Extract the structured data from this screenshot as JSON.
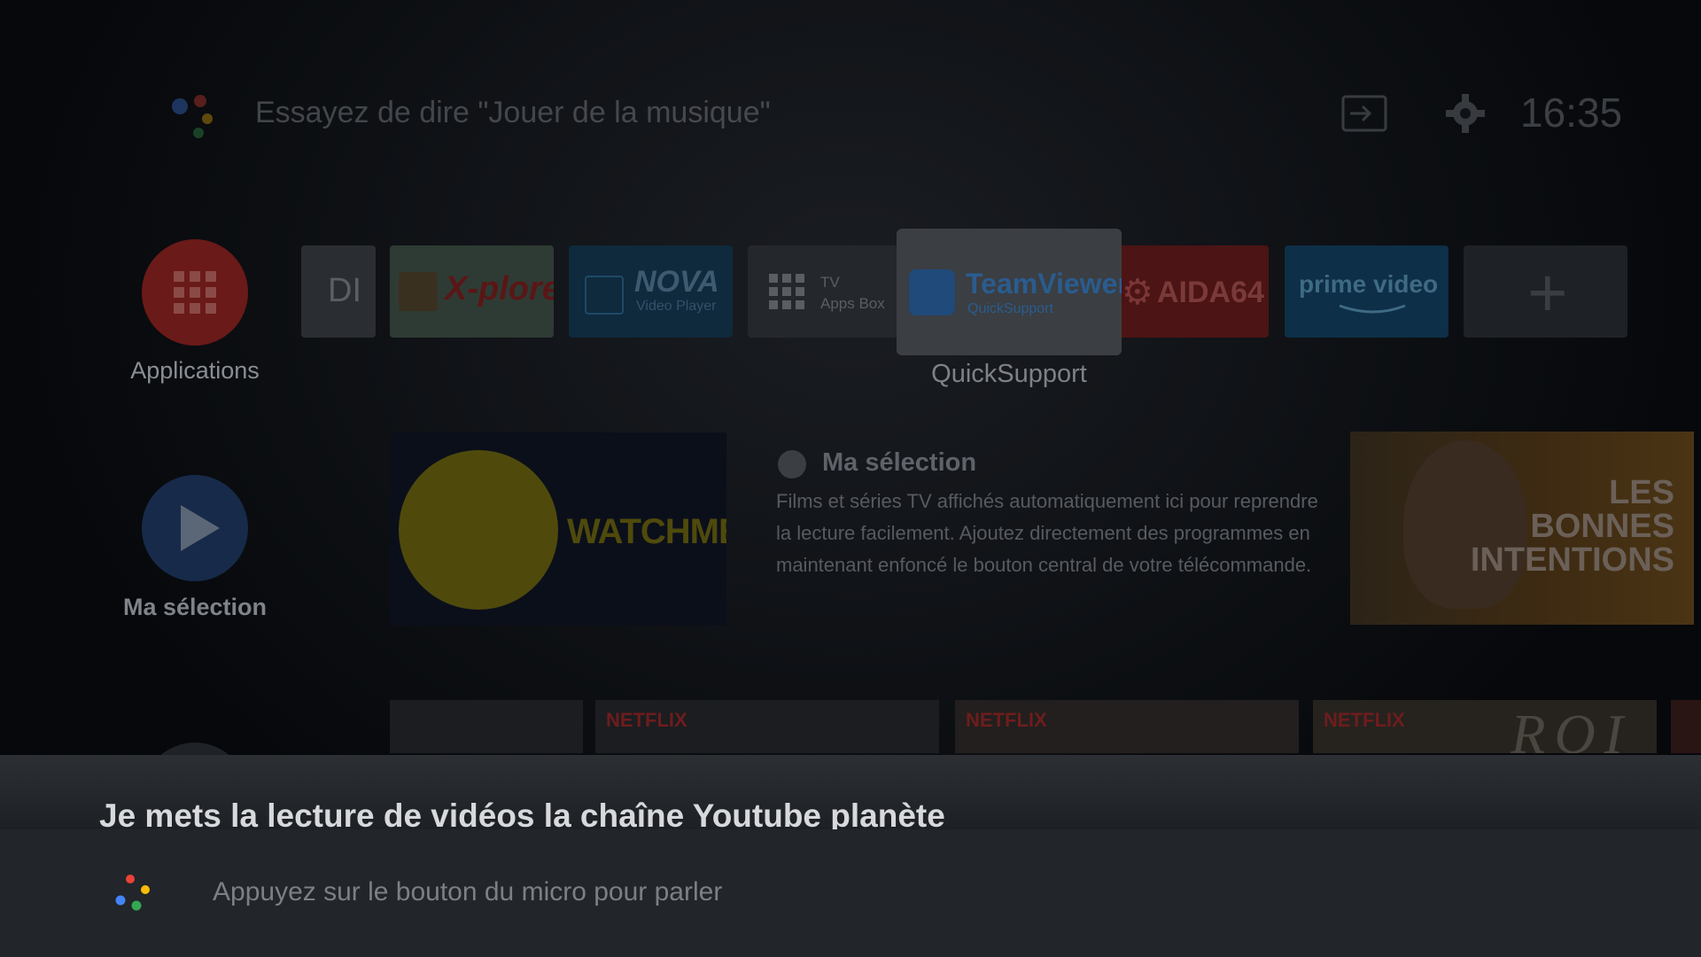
{
  "top_bar": {
    "search_hint": "Essayez de dire \"Jouer de la musique\"",
    "clock": "16:35"
  },
  "apps_row": {
    "applications_label": "Applications",
    "partial_tile_text": "DI",
    "xplore_text": "X-plore",
    "nova_title": "NOVA",
    "nova_subtitle": "Video Player",
    "tvbox_title": "TV",
    "tvbox_subtitle": "Apps Box",
    "teamviewer_title": "TeamViewer",
    "teamviewer_subtitle": "QuickSupport",
    "focused_label": "QuickSupport",
    "aida_text": "AIDA64",
    "prime_text": "prime video",
    "add_text": "+"
  },
  "selection_row": {
    "label": "Ma sélection",
    "heading": "Ma sélection",
    "description": "Films et séries TV affichés automatiquement ici pour reprendre la lecture facilement. Ajoutez directement des programmes en maintenant enfoncé le bouton central de votre télécommande.",
    "watchmen_title": "WATCHMEN",
    "bonnes_line1": "LES",
    "bonnes_line2": "BONNES",
    "bonnes_line3": "INTENTIONS"
  },
  "netflix_row": {
    "logo": "NETFLIX",
    "roi_text": "ROI"
  },
  "assistant": {
    "transcript": "Je mets la lecture de vidéos la chaîne Youtube planète",
    "mic_hint": "Appuyez sur le bouton du micro pour parler"
  },
  "colors": {
    "google_blue": "#4285F4",
    "google_red": "#EA4335",
    "google_yellow": "#FBBC05",
    "google_green": "#34A853"
  }
}
